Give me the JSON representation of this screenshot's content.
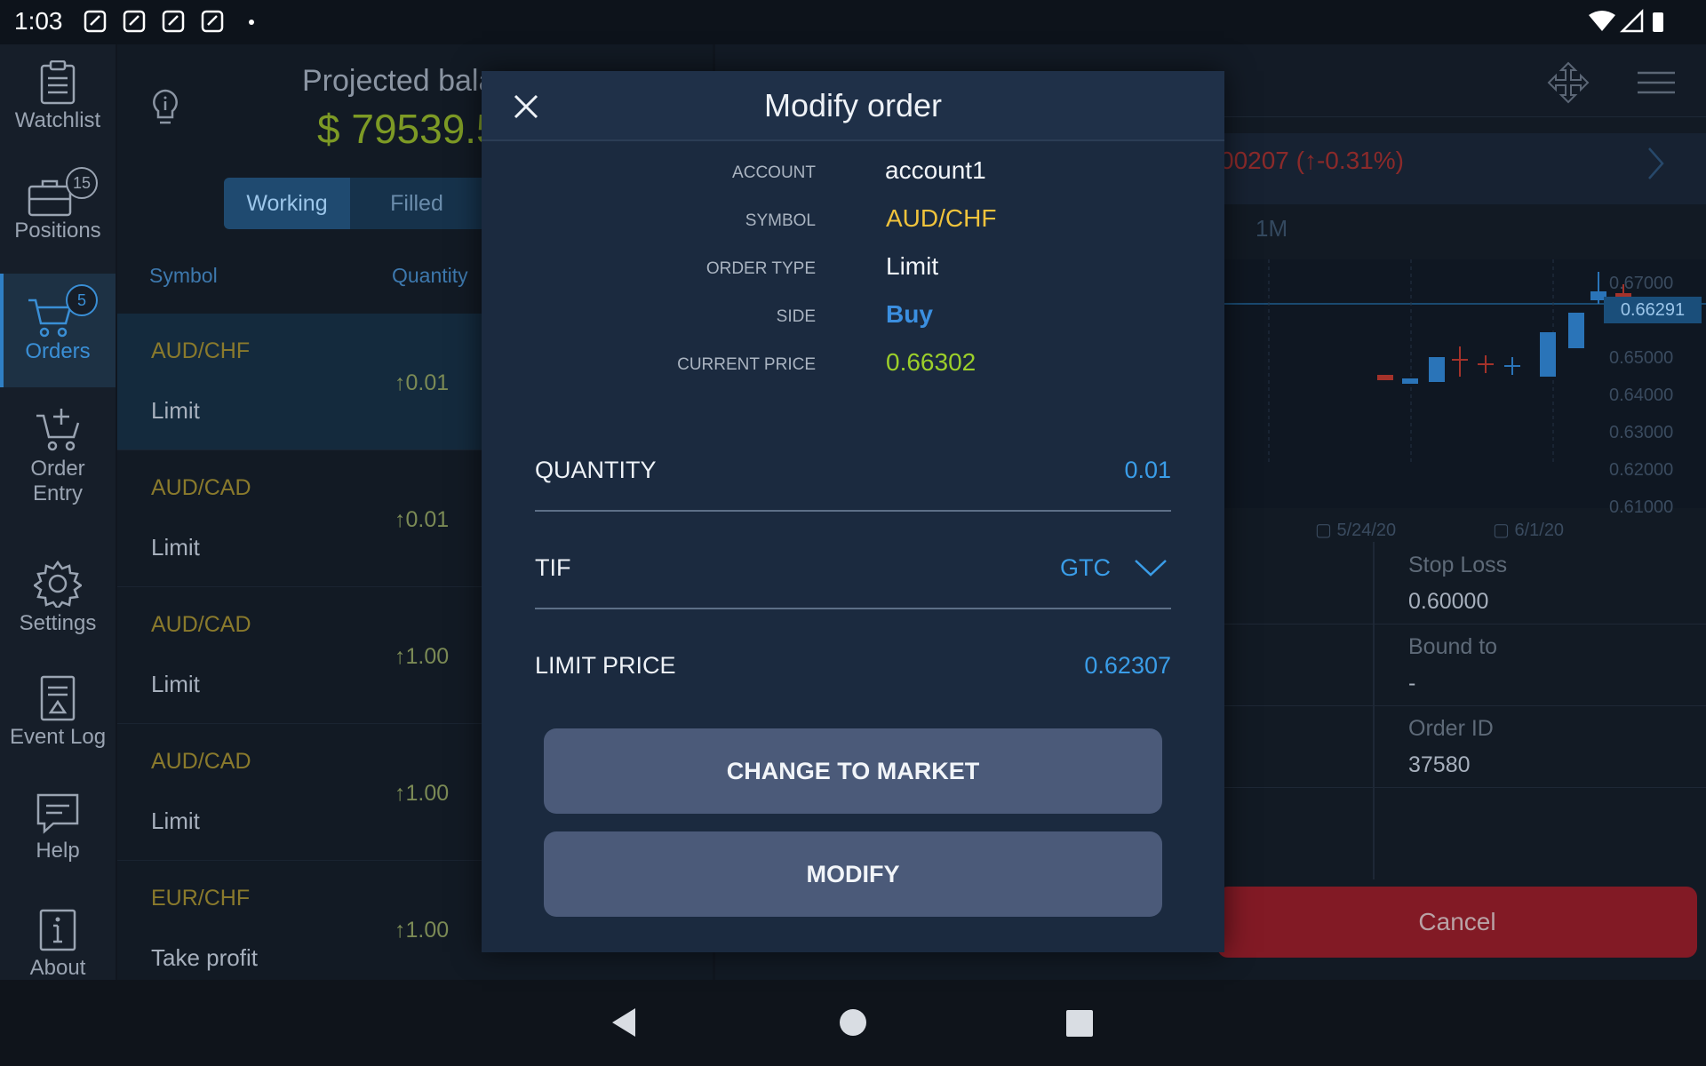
{
  "status_bar": {
    "time": "1:03"
  },
  "sidebar": {
    "items": [
      {
        "label": "Watchlist"
      },
      {
        "label": "Positions",
        "badge": "15"
      },
      {
        "label": "Orders",
        "badge": "5"
      },
      {
        "label": "Order\nEntry"
      },
      {
        "label": "Settings"
      },
      {
        "label": "Event Log"
      },
      {
        "label": "Help"
      },
      {
        "label": "About"
      }
    ]
  },
  "orders_panel": {
    "projected_label": "Projected bala",
    "projected_value": "$ 79539.5",
    "tabs": [
      "Working",
      "Filled"
    ],
    "columns": [
      "Symbol",
      "Quantity"
    ],
    "rows": [
      {
        "symbol": "AUD/CHF",
        "type": "Limit",
        "quantity": "0.01"
      },
      {
        "symbol": "AUD/CAD",
        "type": "Limit",
        "quantity": "0.01"
      },
      {
        "symbol": "AUD/CAD",
        "type": "Limit",
        "quantity": "1.00"
      },
      {
        "symbol": "AUD/CAD",
        "type": "Limit",
        "quantity": "1.00"
      },
      {
        "symbol": "EUR/CHF",
        "type": "Take profit",
        "quantity": "1.00"
      }
    ]
  },
  "detail_panel": {
    "quote_change": "00207 (↑-0.31%)",
    "period": "1M",
    "chart_price_labels": [
      "0.67000",
      "0.66291",
      "0.65000",
      "0.64000",
      "0.63000",
      "0.62000",
      "0.61000"
    ],
    "chart_date_labels": [
      "5/24/20",
      "6/1/20"
    ],
    "stop_loss_label": "Stop Loss",
    "stop_loss_value": "0.60000",
    "bound_to_label": "Bound to",
    "bound_to_value": "-",
    "order_id_label": "Order ID",
    "order_id_value": "37580",
    "cancel_label": "Cancel"
  },
  "modal": {
    "title": "Modify order",
    "details": [
      {
        "label": "ACCOUNT",
        "value": "account1"
      },
      {
        "label": "SYMBOL",
        "value": "AUD/CHF"
      },
      {
        "label": "ORDER TYPE",
        "value": "Limit"
      },
      {
        "label": "SIDE",
        "value": "Buy"
      },
      {
        "label": "CURRENT PRICE",
        "value": "0.66302"
      }
    ],
    "quantity_label": "QUANTITY",
    "quantity_value": "0.01",
    "tif_label": "TIF",
    "tif_value": "GTC",
    "limit_price_label": "LIMIT PRICE",
    "limit_price_value": "0.62307",
    "change_to_market_label": "CHANGE TO MARKET",
    "modify_label": "MODIFY"
  },
  "colors": {
    "accent_blue": "#3a9de8",
    "symbol_yellow": "#f0c33c",
    "side_buy": "#3b8fe0",
    "price_green": "#9ccf2a",
    "cancel_red": "#821a25"
  }
}
